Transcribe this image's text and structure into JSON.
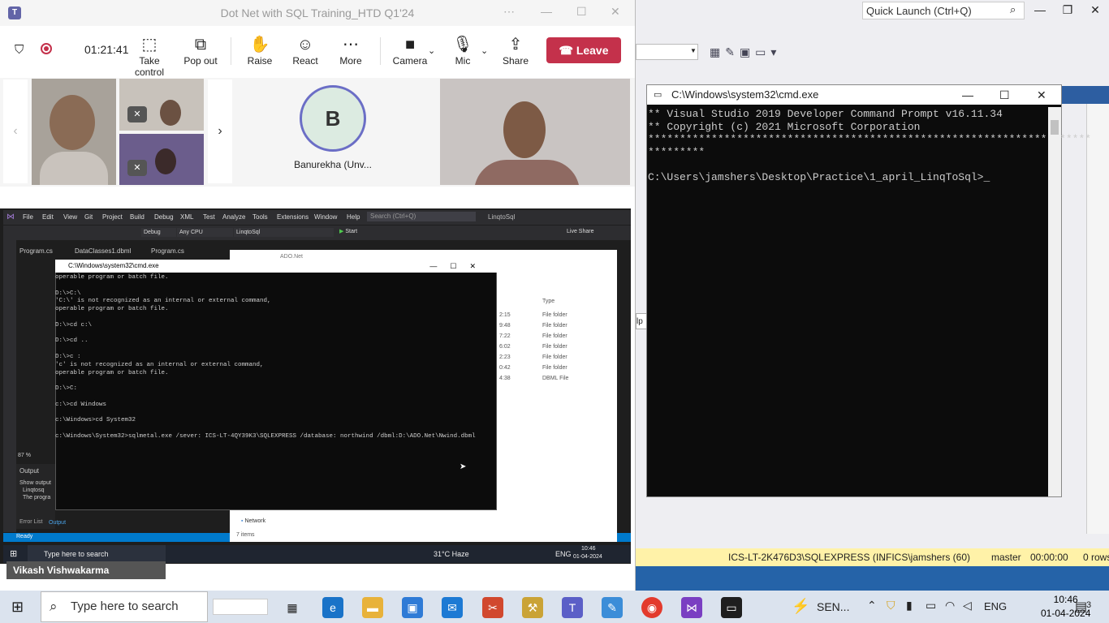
{
  "background_app": {
    "quick_launch": "Quick Launch (Ctrl+Q)",
    "status_bar": {
      "server": "ICS-LT-2K476D3\\SQLEXPRESS (...",
      "user": "INFICS\\jamshers (60)",
      "database": "master",
      "elapsed": "00:00:00",
      "rows": "0 rows"
    },
    "side_label": "lp"
  },
  "teams": {
    "window_title": "Dot Net with SQL Training_HTD Q1'24",
    "timer": "01:21:41",
    "toolbar": {
      "take_control": "Take control",
      "pop_out": "Pop out",
      "raise": "Raise",
      "react": "React",
      "more": "More",
      "camera": "Camera",
      "mic": "Mic",
      "share": "Share",
      "leave": "Leave"
    },
    "participant_avatar_initial": "B",
    "participant_name": "Banurekha (Unv...",
    "presenter_name": "Vikash Vishwakarma"
  },
  "shared_screen": {
    "menu": [
      "File",
      "Edit",
      "View",
      "Git",
      "Project",
      "Build",
      "Debug",
      "XML",
      "Test",
      "Analyze",
      "Tools",
      "Extensions",
      "Window",
      "Help"
    ],
    "search": "Search (Ctrl+Q)",
    "solution": "LinqtoSql",
    "config": "Debug",
    "platform": "Any CPU",
    "project": "LinqtoSql",
    "start": "Start",
    "live_share": "Live Share",
    "tabs": [
      "Program.cs",
      "DataClasses1.dbml",
      "Program.cs"
    ],
    "explorer_path": "ADO.Net",
    "explorer_type_header": "Type",
    "explorer_rows": [
      {
        "time": "2:15",
        "type": "File folder"
      },
      {
        "time": "9:48",
        "type": "File folder"
      },
      {
        "time": "7:22",
        "type": "File folder"
      },
      {
        "time": "6:02",
        "type": "File folder"
      },
      {
        "time": "2:23",
        "type": "File folder"
      },
      {
        "time": "0:42",
        "type": "File folder"
      },
      {
        "time": "4:38",
        "type": "DBML File"
      }
    ],
    "explorer_network": "Network",
    "explorer_items": "7 items",
    "zoom": "87 %",
    "output_label": "Output",
    "show_output": "Show output",
    "output_lines": [
      "Linqtosq",
      "The progra"
    ],
    "bottom_tabs": [
      "Error List",
      "Output"
    ],
    "vs_status": "Ready",
    "cmd_title": "C:\\Windows\\system32\\cmd.exe",
    "cmd_lines": [
      "operable program or batch file.",
      "",
      "D:\\>C:\\",
      "'C:\\' is not recognized as an internal or external command,",
      "operable program or batch file.",
      "",
      "D:\\>cd c:\\",
      "",
      "D:\\>cd ..",
      "",
      "D:\\>c :",
      "'c' is not recognized as an internal or external command,",
      "operable program or batch file.",
      "",
      "D:\\>C:",
      "",
      "c:\\>cd Windows",
      "",
      "c:\\Windows>cd System32",
      "",
      "c:\\Windows\\System32>sqlmetal.exe /sever: ICS-LT-4QY39K3\\SQLEXPRESS /database: northwind /dbml:D:\\ADO.Net\\Nwind.dbml"
    ],
    "taskbar": {
      "search": "Type here to search",
      "weather": "31°C Haze",
      "lang": "ENG",
      "time": "10:46",
      "date": "01-04-2024"
    }
  },
  "cmd_window": {
    "title": "C:\\Windows\\system32\\cmd.exe",
    "lines": [
      "** Visual Studio 2019 Developer Command Prompt v16.11.34",
      "** Copyright (c) 2021 Microsoft Corporation",
      "**********************************************************************",
      "*********",
      "",
      "C:\\Users\\jamshers\\Desktop\\Practice\\1_april_LinqToSql>_"
    ]
  },
  "taskbar": {
    "search_placeholder": "Type here to search",
    "tray_app_label": "SEN...",
    "language": "ENG",
    "time": "10:46",
    "date": "01-04-2024",
    "notifications_count": "3"
  },
  "colors": {
    "teams_leave": "#c4314b",
    "teams_purple": "#6264a7",
    "vs_blue": "#007acc",
    "ssms_status_yellow": "#fff2a8"
  }
}
